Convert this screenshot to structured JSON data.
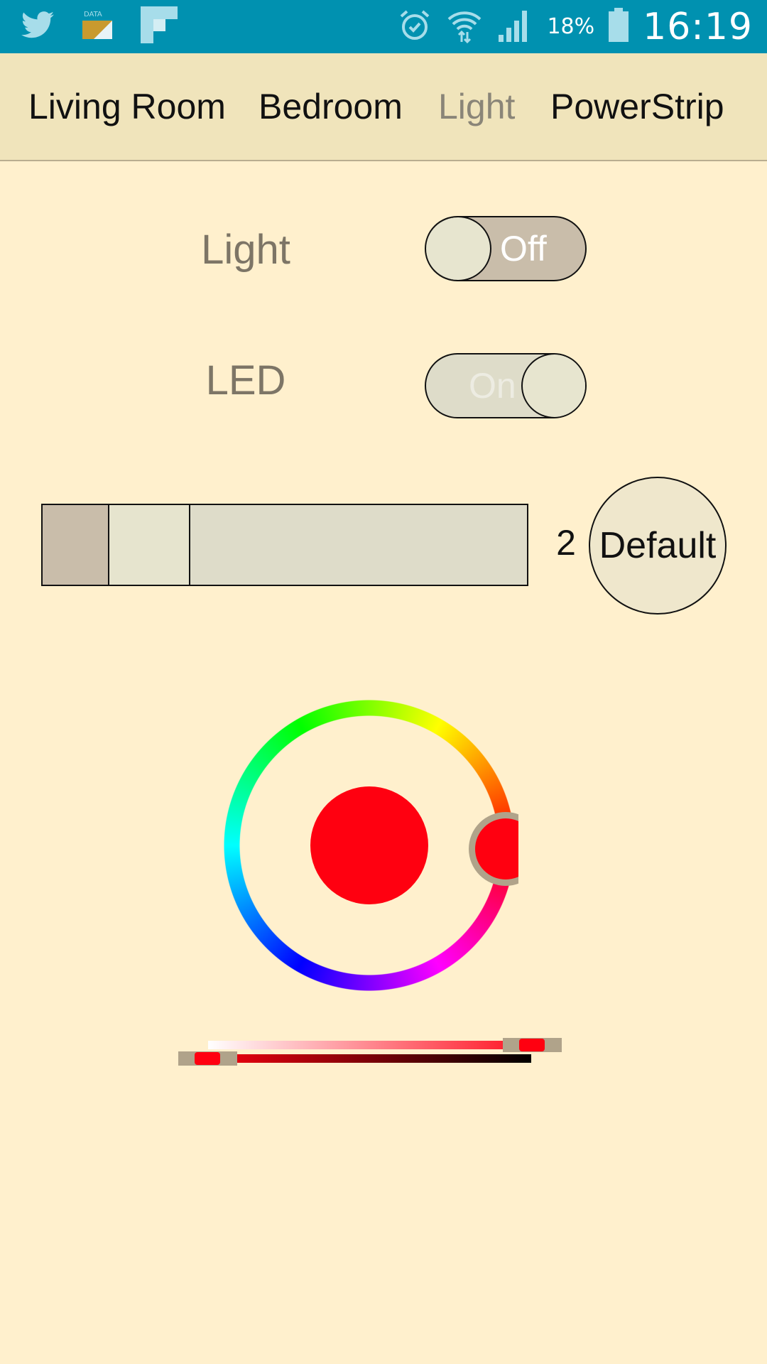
{
  "status_bar": {
    "time": "16:19",
    "battery_percent": "18%",
    "icons": [
      "twitter-icon",
      "data-saver-icon",
      "flipboard-icon",
      "alarm-icon",
      "wifi-icon",
      "signal-icon",
      "battery-icon"
    ]
  },
  "tabs": [
    {
      "label": "Living Room",
      "active": false
    },
    {
      "label": "Bedroom",
      "active": false
    },
    {
      "label": "Light",
      "active": true
    },
    {
      "label": "PowerStrip",
      "active": false
    }
  ],
  "controls": {
    "light": {
      "label": "Light",
      "toggle_text": "Off",
      "state": "off"
    },
    "led": {
      "label": "LED",
      "toggle_text": "On",
      "state": "on"
    },
    "segment": {
      "value": "2",
      "default_label": "Default"
    }
  },
  "color_picker": {
    "selected_color": "#FF0010",
    "hue_degrees": 0,
    "saturation": 0.88,
    "value": 0.06
  },
  "colors": {
    "background": "#FFF0CD",
    "tabbar": "#F0E4BB",
    "statusbar": "#0091B0",
    "accent_red": "#FF0010"
  }
}
